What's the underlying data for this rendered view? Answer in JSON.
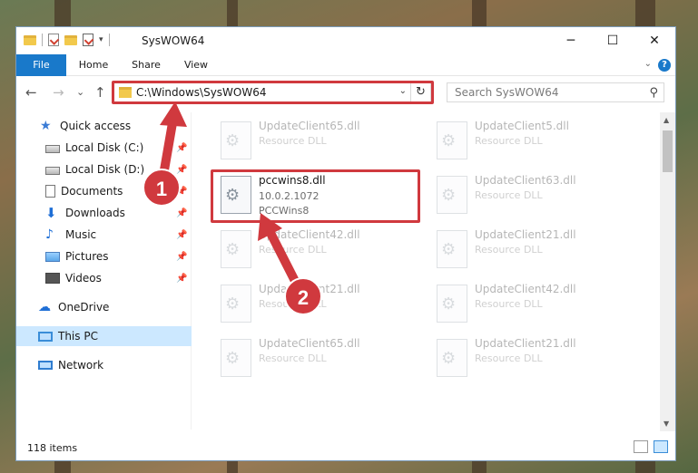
{
  "window": {
    "title": "SysWOW64",
    "controls": {
      "minimize": "─",
      "maximize": "☐",
      "close": "✕"
    }
  },
  "ribbon": {
    "tabs": [
      "File",
      "Home",
      "Share",
      "View"
    ],
    "help": "?"
  },
  "navigation": {
    "back": "←",
    "forward": "→",
    "recent": "⌄",
    "up": "↑",
    "address": "C:\\Windows\\SysWOW64",
    "refresh": "↻",
    "search_placeholder": "Search SysWOW64"
  },
  "sidebar": {
    "items": [
      {
        "label": "Quick access",
        "icon": "star-icon",
        "pinned": false
      },
      {
        "label": "Local Disk (C:)",
        "icon": "drive-icon",
        "pinned": true
      },
      {
        "label": "Local Disk (D:)",
        "icon": "drive-icon",
        "pinned": true
      },
      {
        "label": "Documents",
        "icon": "document-icon",
        "pinned": true
      },
      {
        "label": "Downloads",
        "icon": "download-icon",
        "pinned": true
      },
      {
        "label": "Music",
        "icon": "music-icon",
        "pinned": true
      },
      {
        "label": "Pictures",
        "icon": "pictures-icon",
        "pinned": true
      },
      {
        "label": "Videos",
        "icon": "video-icon",
        "pinned": true
      },
      {
        "label": "OneDrive",
        "icon": "cloud-icon",
        "pinned": false
      },
      {
        "label": "This PC",
        "icon": "computer-icon",
        "pinned": false,
        "selected": true
      },
      {
        "label": "Network",
        "icon": "network-icon",
        "pinned": false
      }
    ]
  },
  "files": [
    {
      "name": "UpdateClient65.dll",
      "line2": "Resource DLL",
      "faded": true
    },
    {
      "name": "UpdateClient5.dll",
      "line2": "Resource DLL",
      "faded": true
    },
    {
      "name": "pccwins8.dll",
      "line2": "10.0.2.1072",
      "line3": "PCCWins8",
      "faded": false
    },
    {
      "name": "UpdateClient63.dll",
      "line2": "Resource DLL",
      "faded": true
    },
    {
      "name": "UpdateClient42.dll",
      "line2": "Resource DLL",
      "faded": true
    },
    {
      "name": "UpdateClient21.dll",
      "line2": "Resource DLL",
      "faded": true
    },
    {
      "name": "UpdateClient21.dll",
      "line2": "Resource DLL",
      "faded": true
    },
    {
      "name": "UpdateClient42.dll",
      "line2": "Resource DLL",
      "faded": true
    },
    {
      "name": "UpdateClient65.dll",
      "line2": "Resource DLL",
      "faded": true
    },
    {
      "name": "UpdateClient21.dll",
      "line2": "Resource DLL",
      "faded": true
    }
  ],
  "status": {
    "item_count": "118 items"
  },
  "annotations": {
    "step1": "1",
    "step2": "2",
    "highlight_color": "#d0393e"
  }
}
